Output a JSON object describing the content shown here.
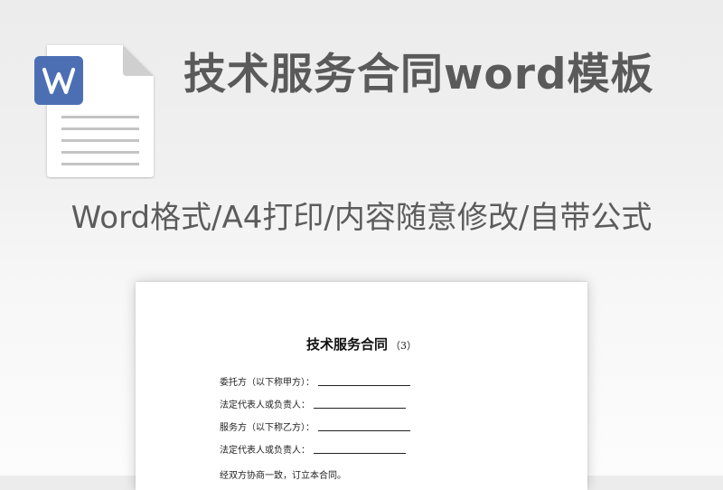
{
  "header": {
    "icon_badge_letter": "W",
    "title": "技术服务合同word模板",
    "subtitle": "Word格式/A4打印/内容随意修改/自带公式"
  },
  "colors": {
    "badge": "#4c6fb4",
    "title_text": "#5a5a5a",
    "file_body": "#ffffff",
    "file_fold": "#c9c9c9",
    "file_lines": "#c2c2c2"
  },
  "document": {
    "title": "技术服务合同",
    "title_suffix": "（3）",
    "fields": [
      {
        "label": "委托方（以下称甲方）："
      },
      {
        "label": "法定代表人或负责人："
      },
      {
        "label": "服务方（以下称乙方）："
      },
      {
        "label": "法定代表人或负责人："
      }
    ],
    "body_text": "经双方协商一致，订立本合同。"
  }
}
